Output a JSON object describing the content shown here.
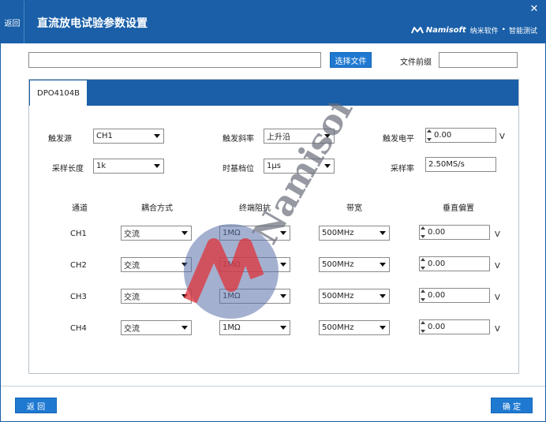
{
  "titlebar": {
    "back_label": "返回",
    "title": "直流放电试验参数设置",
    "brand_name": "Namisoft",
    "brand_part1": "纳米软件",
    "brand_dot": "•",
    "brand_part2": "智能测试",
    "close_symbol": "✕"
  },
  "file_row": {
    "path_value": "",
    "choose_label": "选择文件",
    "prefix_label": "文件前缀",
    "prefix_value": ""
  },
  "tabs": [
    {
      "label": "DPO4104B",
      "active": true
    }
  ],
  "trigger": {
    "source_label": "触发源",
    "source_value": "CH1",
    "slope_label": "触发斜率",
    "slope_value": "上升沿",
    "level_label": "触发电平",
    "level_value": "0.00",
    "level_unit": "V",
    "length_label": "采样长度",
    "length_value": "1k",
    "timebase_label": "时基档位",
    "timebase_value": "1μs",
    "rate_label": "采样率",
    "rate_value": "2.50MS/s"
  },
  "channel_table": {
    "headers": [
      "通道",
      "耦合方式",
      "终端阻抗",
      "带宽",
      "垂直偏置"
    ],
    "rows": [
      {
        "channel": "CH1",
        "coupling": "交流",
        "impedance": "1MΩ",
        "bandwidth": "500MHz",
        "offset": "0.00",
        "unit": "V"
      },
      {
        "channel": "CH2",
        "coupling": "交流",
        "impedance": "1MΩ",
        "bandwidth": "500MHz",
        "offset": "0.00",
        "unit": "V"
      },
      {
        "channel": "CH3",
        "coupling": "交流",
        "impedance": "1MΩ",
        "bandwidth": "500MHz",
        "offset": "0.00",
        "unit": "V"
      },
      {
        "channel": "CH4",
        "coupling": "交流",
        "impedance": "1MΩ",
        "bandwidth": "500MHz",
        "offset": "0.00",
        "unit": "V"
      }
    ]
  },
  "watermark_text": "Namisoft",
  "footer": {
    "back_label": "返  回",
    "ok_label": "确  定"
  },
  "colors": {
    "primary": "#1a5fa8",
    "button": "#1f79d1",
    "watermark_red": "#e0333a",
    "watermark_blue": "#5a6fa8"
  },
  "icons": [
    "close-icon",
    "dropdown-arrow-icon",
    "spinner-icon",
    "namisoft-logo-icon"
  ]
}
